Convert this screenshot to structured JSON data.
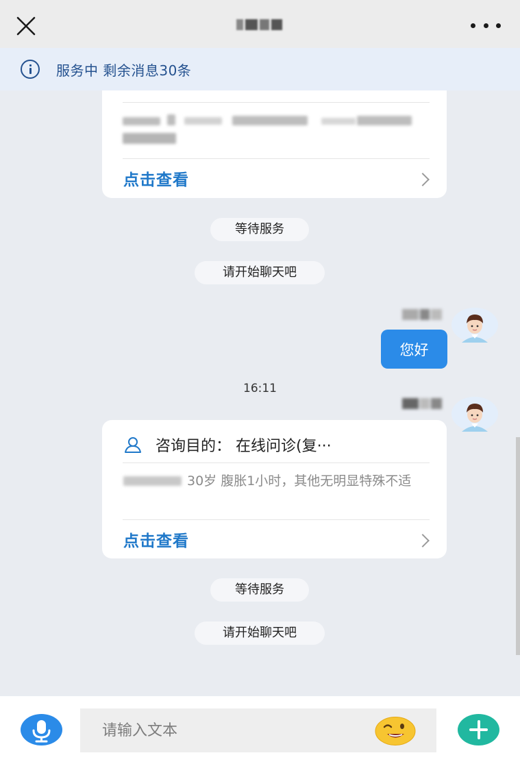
{
  "header": {
    "title": "",
    "close_icon": "close-icon",
    "more_icon": "more-icon"
  },
  "service_bar": {
    "icon": "info-icon",
    "text": "服务中 剩余消息30条"
  },
  "messages": {
    "card_1": {
      "desc_tail": "",
      "link_label": "点击查看"
    },
    "pill_1": "等待服务",
    "pill_2": "请开始聊天吧",
    "user_bubble": "您好",
    "timestamp": "16:11",
    "card_2": {
      "title": "咨询目的： 在线问诊(复···",
      "desc": "30岁 腹胀1小时，其他无明显特殊不适",
      "link_label": "点击查看"
    },
    "pill_3": "等待服务",
    "pill_4": "请开始聊天吧"
  },
  "input": {
    "placeholder": "请输入文本"
  },
  "colors": {
    "accent": "#2b8be8",
    "link": "#1f78c9",
    "service_text": "#24518f",
    "add_button": "#21b8a0",
    "background": "#e9ecf1"
  }
}
